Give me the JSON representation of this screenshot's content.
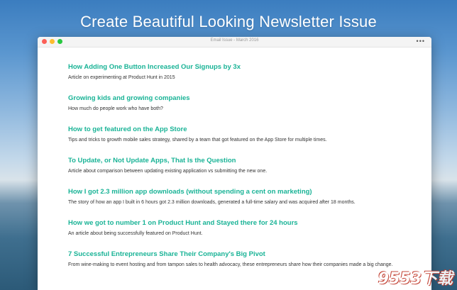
{
  "headline": "Create Beautiful Looking Newsletter Issue",
  "window": {
    "title": "Email Issue - March 2016",
    "traffic_lights": [
      "close",
      "minimize",
      "zoom"
    ],
    "more_label": "•••"
  },
  "articles": [
    {
      "title": "How Adding One Button Increased Our Signups by 3x",
      "description": "Article on experimenting at Product Hunt in 2015"
    },
    {
      "title": "Growing kids and growing companies",
      "description": "How much do people work who have both?"
    },
    {
      "title": "How to get featured on the App Store",
      "description": "Tips and tricks to growth mobile sales strategy, shared by a team that got featured on the App Store for multiple times."
    },
    {
      "title": "To Update, or Not Update Apps, That Is the Question",
      "description": "Article about comparison between updating existing application vs submitting the new one."
    },
    {
      "title": "How I got 2.3 million app downloads (without spending a cent on marketing)",
      "description": "The story of how an app I built in 6 hours got 2.3 million downloads, generated a full-time salary and was acquired after 18 months."
    },
    {
      "title": "How we got to number 1 on Product Hunt and Stayed there for 24 hours",
      "description": "An article about being successfully featured on Product Hunt."
    },
    {
      "title": "7 Successful Entrepreneurs Share Their Company's Big Pivot",
      "description": "From wine-making to event hosting and from tampon sales to health advocacy, these entrepreneurs share how their companies made a big change."
    }
  ],
  "watermark": "9553下载",
  "colors": {
    "title": "#19b396",
    "text": "#333333"
  }
}
